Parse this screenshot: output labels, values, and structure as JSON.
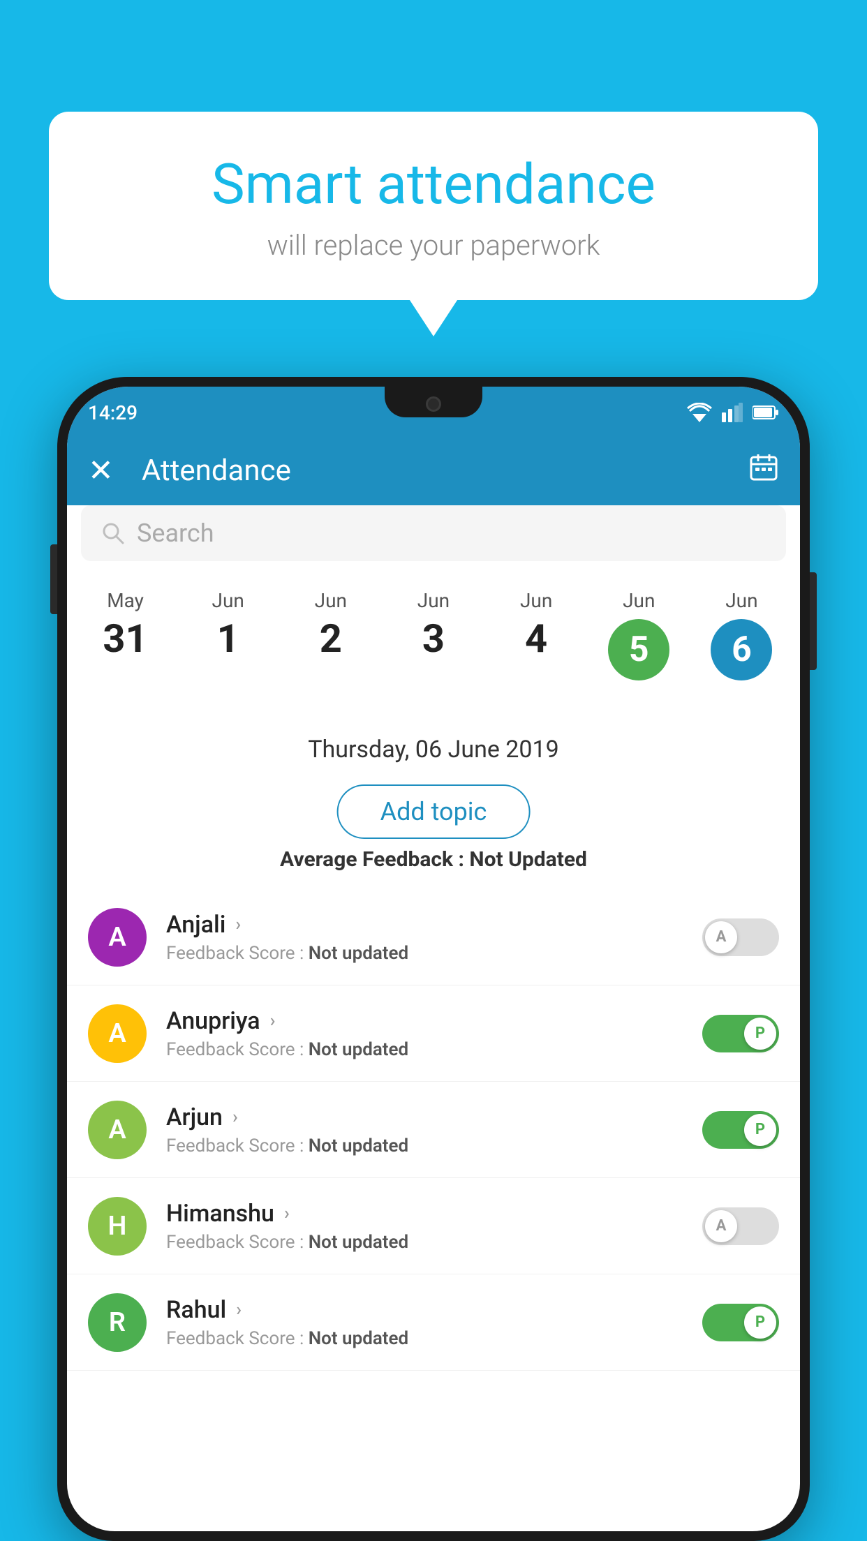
{
  "background_color": "#17b8e8",
  "speech_bubble": {
    "title": "Smart attendance",
    "subtitle": "will replace your paperwork"
  },
  "status_bar": {
    "time": "14:29"
  },
  "app_bar": {
    "title": "Attendance",
    "close_label": "×",
    "calendar_label": "📅"
  },
  "search": {
    "placeholder": "Search"
  },
  "date_strip": {
    "dates": [
      {
        "month": "May",
        "day": "31",
        "selected": false
      },
      {
        "month": "Jun",
        "day": "1",
        "selected": false
      },
      {
        "month": "Jun",
        "day": "2",
        "selected": false
      },
      {
        "month": "Jun",
        "day": "3",
        "selected": false
      },
      {
        "month": "Jun",
        "day": "4",
        "selected": false
      },
      {
        "month": "Jun",
        "day": "5",
        "selected": "green"
      },
      {
        "month": "Jun",
        "day": "6",
        "selected": "blue"
      }
    ]
  },
  "selected_date_label": "Thursday, 06 June 2019",
  "add_topic_label": "Add topic",
  "avg_feedback_label": "Average Feedback : ",
  "avg_feedback_value": "Not Updated",
  "students": [
    {
      "name": "Anjali",
      "avatar_letter": "A",
      "avatar_color": "#9c27b0",
      "feedback_label": "Feedback Score : ",
      "feedback_value": "Not updated",
      "attendance": "absent"
    },
    {
      "name": "Anupriya",
      "avatar_letter": "A",
      "avatar_color": "#ffc107",
      "feedback_label": "Feedback Score : ",
      "feedback_value": "Not updated",
      "attendance": "present"
    },
    {
      "name": "Arjun",
      "avatar_letter": "A",
      "avatar_color": "#8bc34a",
      "feedback_label": "Feedback Score : ",
      "feedback_value": "Not updated",
      "attendance": "present"
    },
    {
      "name": "Himanshu",
      "avatar_letter": "H",
      "avatar_color": "#8bc34a",
      "feedback_label": "Feedback Score : ",
      "feedback_value": "Not updated",
      "attendance": "absent"
    },
    {
      "name": "Rahul",
      "avatar_letter": "R",
      "avatar_color": "#4caf50",
      "feedback_label": "Feedback Score : ",
      "feedback_value": "Not updated",
      "attendance": "present"
    }
  ]
}
